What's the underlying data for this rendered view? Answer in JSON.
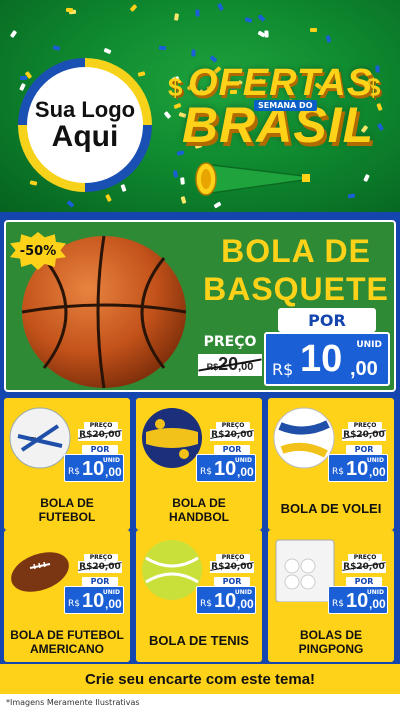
{
  "header": {
    "logo_line1": "Sua Logo",
    "logo_line2": "Aqui",
    "ofertas": "OFERTAS",
    "semana": "SEMANA DO",
    "brasil": "BRASIL",
    "dollar_sign": "$"
  },
  "featured": {
    "discount": "-50%",
    "title_line1": "BOLA DE",
    "title_line2": "BASQUETE",
    "preco_label": "PREÇO",
    "old_currency": "R$",
    "old_int": "20",
    "old_dec": ",00",
    "por_label": "POR",
    "unid_label": "UNID",
    "new_currency": "R$",
    "new_int": "10",
    "new_dec": ",00"
  },
  "products": [
    {
      "name_line1": "BOLA DE",
      "name_line2": "FUTEBOL",
      "preco_label": "PREÇO",
      "old_price": "R$20,00",
      "por_label": "POR",
      "unid": "UNID",
      "currency": "R$",
      "int": "10",
      "dec": ",00"
    },
    {
      "name_line1": "BOLA DE",
      "name_line2": "HANDBOL",
      "preco_label": "PREÇO",
      "old_price": "R$20,00",
      "por_label": "POR",
      "unid": "UNID",
      "currency": "R$",
      "int": "10",
      "dec": ",00"
    },
    {
      "name_line1": "BOLA DE VOLEI",
      "name_line2": "",
      "preco_label": "PREÇO",
      "old_price": "R$20,00",
      "por_label": "POR",
      "unid": "UNID",
      "currency": "R$",
      "int": "10",
      "dec": ",00"
    },
    {
      "name_line1": "BOLA DE FUTEBOL",
      "name_line2": "AMERICANO",
      "preco_label": "PREÇO",
      "old_price": "R$20,00",
      "por_label": "POR",
      "unid": "UNID",
      "currency": "R$",
      "int": "10",
      "dec": ",00"
    },
    {
      "name_line1": "BOLA DE TENIS",
      "name_line2": "",
      "preco_label": "PREÇO",
      "old_price": "R$20,00",
      "por_label": "POR",
      "unid": "UNID",
      "currency": "R$",
      "int": "10",
      "dec": ",00"
    },
    {
      "name_line1": "BOLAS DE",
      "name_line2": "PINGPONG",
      "preco_label": "PREÇO",
      "old_price": "R$20,00",
      "por_label": "POR",
      "unid": "UNID",
      "currency": "R$",
      "int": "10",
      "dec": ",00"
    }
  ],
  "banner": "Crie seu encarte com este tema!",
  "footer": "*Imagens Meramente Ilustrativas",
  "colors": {
    "green": "#0f8a30",
    "yellow": "#ffd21a",
    "blue": "#1546b0",
    "price_blue": "#1a5fd6"
  }
}
